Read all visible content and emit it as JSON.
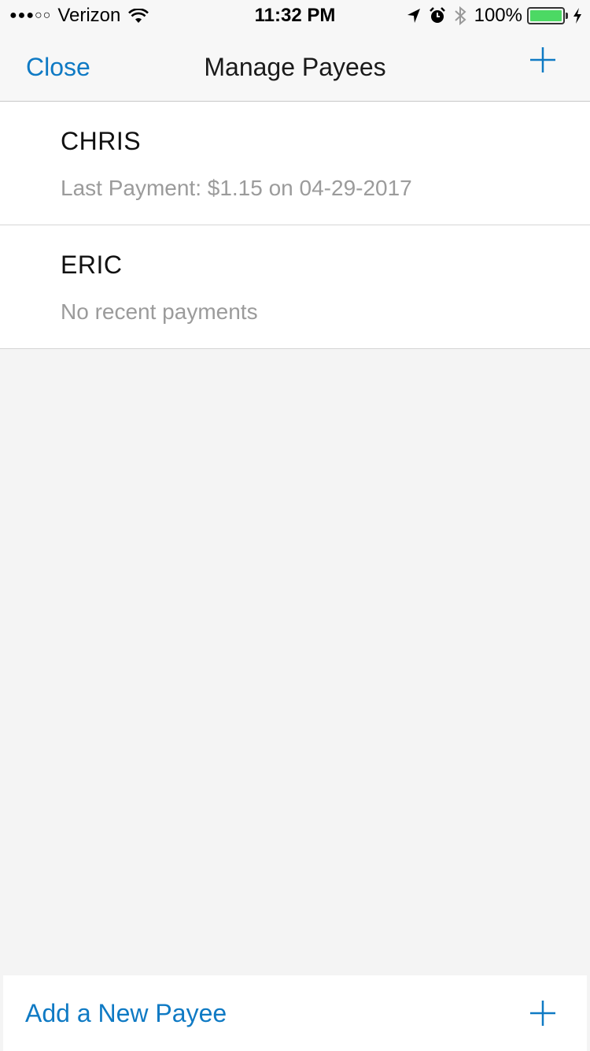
{
  "status_bar": {
    "signal": "●●●○○",
    "carrier": "Verizon",
    "time": "11:32 PM",
    "battery_percent": "100%",
    "battery_level": 1.0
  },
  "nav": {
    "close_label": "Close",
    "title": "Manage Payees"
  },
  "payees": [
    {
      "name": "CHRIS",
      "detail": "Last Payment: $1.15 on 04-29-2017"
    },
    {
      "name": "ERIC",
      "detail": "No recent payments"
    }
  ],
  "footer": {
    "add_label": "Add a New Payee"
  },
  "colors": {
    "accent": "#0f7ac4",
    "background": "#f4f4f4",
    "secondary_text": "#9b9b9b",
    "battery": "#4cd964"
  }
}
